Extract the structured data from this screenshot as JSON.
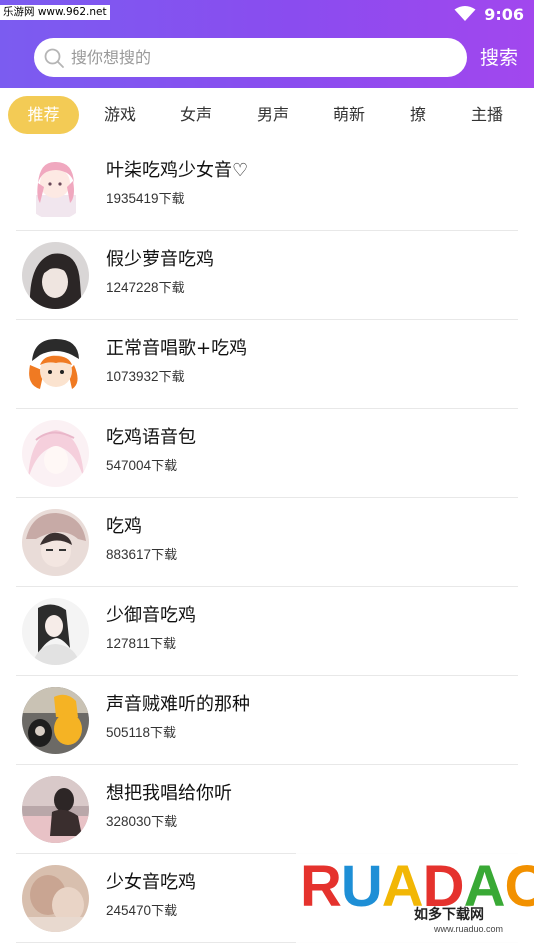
{
  "status_bar": {
    "site_watermark": "乐游网 www.962.net",
    "time": "9:06"
  },
  "search": {
    "placeholder": "搜你想搜的",
    "button_label": "搜索"
  },
  "tabs": [
    {
      "label": "推荐",
      "active": true
    },
    {
      "label": "游戏"
    },
    {
      "label": "女声"
    },
    {
      "label": "男声"
    },
    {
      "label": "萌新"
    },
    {
      "label": "撩"
    },
    {
      "label": "主播"
    }
  ],
  "items": [
    {
      "title": "叶柒吃鸡少女音♡",
      "count": "1935419",
      "suffix": "下载"
    },
    {
      "title": "假少萝音吃鸡",
      "count": "1247228",
      "suffix": "下载"
    },
    {
      "title": "正常音唱歌+吃鸡",
      "count": "1073932",
      "suffix": "下载"
    },
    {
      "title": "吃鸡语音包",
      "count": "547004",
      "suffix": "下载"
    },
    {
      "title": "吃鸡",
      "count": "883617",
      "suffix": "下载"
    },
    {
      "title": "少御音吃鸡",
      "count": "127811",
      "suffix": "下载"
    },
    {
      "title": "声音贼难听的那种",
      "count": "505118",
      "suffix": "下载"
    },
    {
      "title": "想把我唱给你听",
      "count": "328030",
      "suffix": "下载"
    },
    {
      "title": "少女音吃鸡",
      "count": "245470",
      "suffix": "下载"
    }
  ],
  "watermark": {
    "brand": "RUANDUO",
    "cn_name": "如多下载网",
    "url": "www.ruaduo.com"
  },
  "colors": {
    "header_start": "#7b5cf0",
    "header_end": "#a247ee",
    "active_tab": "#f3cb55"
  }
}
